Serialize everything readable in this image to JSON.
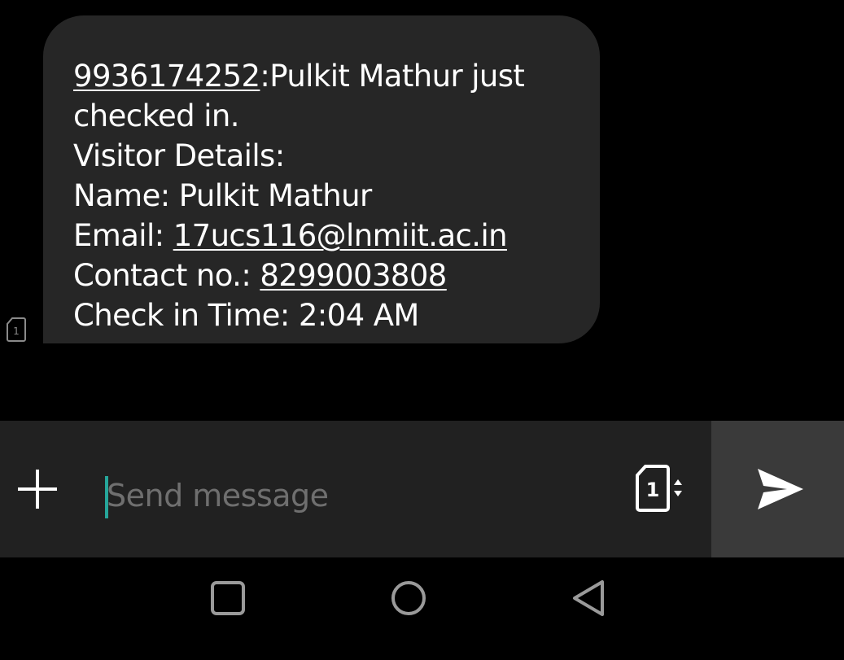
{
  "message": {
    "sim_badge": "1",
    "lines": {
      "l1_phone": "9936174252",
      "l1_text": ":Pulkit Mathur just",
      "l2": "checked in.",
      "l3": "Visitor Details:",
      "l4": "Name: Pulkit Mathur",
      "l5_label": "Email: ",
      "l5_email": "17ucs116@lnmiit.ac.in",
      "l6_label": "Contact no.: ",
      "l6_phone": "8299003808",
      "l7": "Check in Time: 2:04 AM"
    }
  },
  "composer": {
    "placeholder": "Send message",
    "sim_slot": "1"
  },
  "icons": {
    "add": "plus-icon",
    "sim": "sim-card-icon",
    "send": "send-icon",
    "recents": "square-icon",
    "home": "circle-icon",
    "back": "triangle-icon"
  },
  "colors": {
    "bubble": "#262626",
    "composer": "#212121",
    "send_area": "#3a3a3a",
    "caret": "#26a69a",
    "placeholder": "#6f6f6f"
  }
}
